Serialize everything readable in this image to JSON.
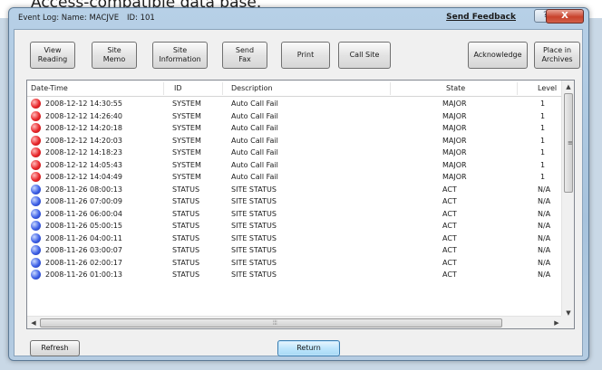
{
  "background_caption": "Access-compatible data base.",
  "window": {
    "title": "Event Log: Name: MACJVE",
    "id_label": "ID: 101",
    "send_feedback": "Send Feedback",
    "help_glyph": "?",
    "close_glyph": "X"
  },
  "toolbar": {
    "view_reading": "View\nReading",
    "site_memo": "Site\nMemo",
    "site_information": "Site\nInformation",
    "send_fax": "Send\nFax",
    "print": "Print",
    "call_site": "Call Site",
    "acknowledge": "Acknowledge",
    "place_in_archives": "Place in\nArchives"
  },
  "table": {
    "columns": [
      "Date-Time",
      "ID",
      "Description",
      "State",
      "Level"
    ],
    "rows": [
      {
        "status_icon": "red-alarm-icon",
        "datetime": "2008-12-12 14:30:55",
        "id": "SYSTEM",
        "description": "Auto Call Fail",
        "state": "MAJOR",
        "level": "1"
      },
      {
        "status_icon": "red-alarm-icon",
        "datetime": "2008-12-12 14:26:40",
        "id": "SYSTEM",
        "description": "Auto Call Fail",
        "state": "MAJOR",
        "level": "1"
      },
      {
        "status_icon": "red-alarm-icon",
        "datetime": "2008-12-12 14:20:18",
        "id": "SYSTEM",
        "description": "Auto Call Fail",
        "state": "MAJOR",
        "level": "1"
      },
      {
        "status_icon": "red-alarm-icon",
        "datetime": "2008-12-12 14:20:03",
        "id": "SYSTEM",
        "description": "Auto Call Fail",
        "state": "MAJOR",
        "level": "1"
      },
      {
        "status_icon": "red-alarm-icon",
        "datetime": "2008-12-12 14:18:23",
        "id": "SYSTEM",
        "description": "Auto Call Fail",
        "state": "MAJOR",
        "level": "1"
      },
      {
        "status_icon": "red-alarm-icon",
        "datetime": "2008-12-12 14:05:43",
        "id": "SYSTEM",
        "description": "Auto Call Fail",
        "state": "MAJOR",
        "level": "1"
      },
      {
        "status_icon": "red-alarm-icon",
        "datetime": "2008-12-12 14:04:49",
        "id": "SYSTEM",
        "description": "Auto Call Fail",
        "state": "MAJOR",
        "level": "1"
      },
      {
        "status_icon": "blue-status-icon",
        "datetime": "2008-11-26 08:00:13",
        "id": "STATUS",
        "description": "SITE STATUS",
        "state": "ACT",
        "level": "N/A"
      },
      {
        "status_icon": "blue-status-icon",
        "datetime": "2008-11-26 07:00:09",
        "id": "STATUS",
        "description": "SITE STATUS",
        "state": "ACT",
        "level": "N/A"
      },
      {
        "status_icon": "blue-status-icon",
        "datetime": "2008-11-26 06:00:04",
        "id": "STATUS",
        "description": "SITE STATUS",
        "state": "ACT",
        "level": "N/A"
      },
      {
        "status_icon": "blue-status-icon",
        "datetime": "2008-11-26 05:00:15",
        "id": "STATUS",
        "description": "SITE STATUS",
        "state": "ACT",
        "level": "N/A"
      },
      {
        "status_icon": "blue-status-icon",
        "datetime": "2008-11-26 04:00:11",
        "id": "STATUS",
        "description": "SITE STATUS",
        "state": "ACT",
        "level": "N/A"
      },
      {
        "status_icon": "blue-status-icon",
        "datetime": "2008-11-26 03:00:07",
        "id": "STATUS",
        "description": "SITE STATUS",
        "state": "ACT",
        "level": "N/A"
      },
      {
        "status_icon": "blue-status-icon",
        "datetime": "2008-11-26 02:00:17",
        "id": "STATUS",
        "description": "SITE STATUS",
        "state": "ACT",
        "level": "N/A"
      },
      {
        "status_icon": "blue-status-icon",
        "datetime": "2008-11-26 01:00:13",
        "id": "STATUS",
        "description": "SITE STATUS",
        "state": "ACT",
        "level": "N/A"
      }
    ]
  },
  "footer": {
    "refresh": "Refresh",
    "return": "Return"
  },
  "colors": {
    "major_alarm": "#e8262a",
    "status": "#3c5fe6",
    "window_frame": "#a7c3dd"
  }
}
